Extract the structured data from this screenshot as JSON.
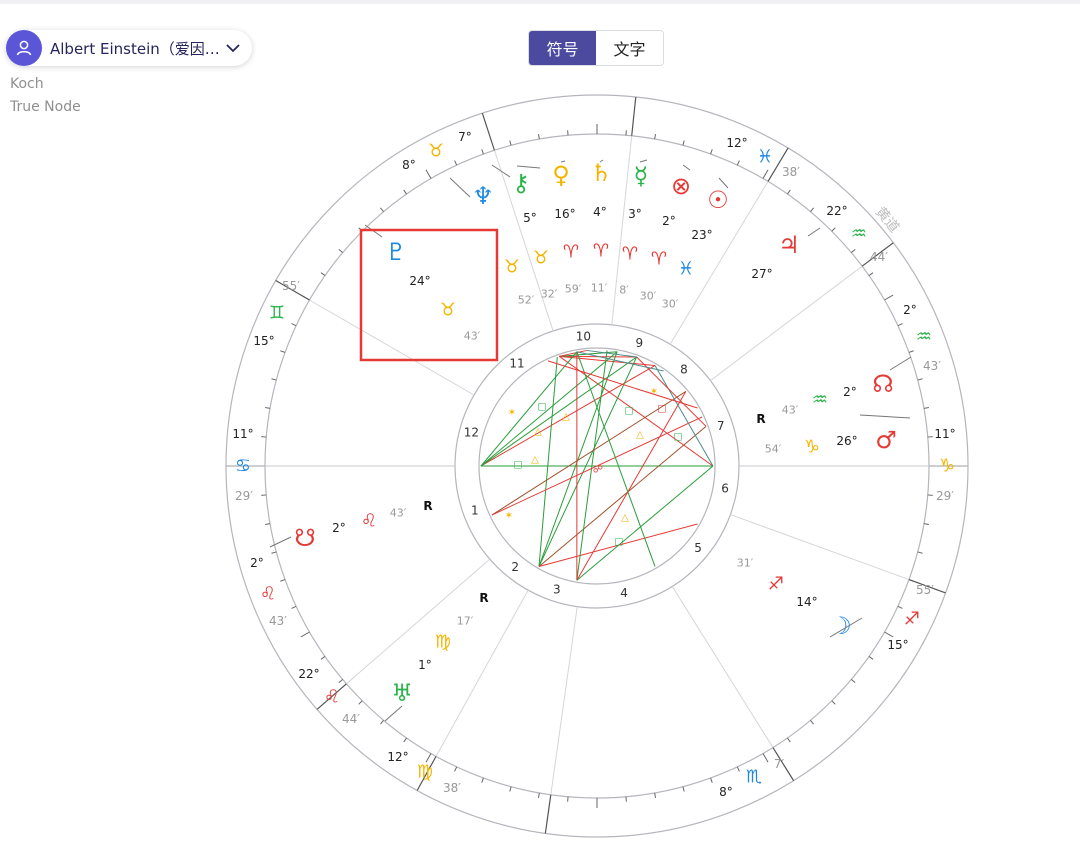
{
  "person": {
    "name": "Albert Einstein（爱因…",
    "avatar_icon": "user-icon",
    "dropdown_icon": "chevron-down-icon"
  },
  "house_system": "Koch",
  "node_type": "True Node",
  "view_toggle": {
    "symbol_label": "符号",
    "text_label": "文字",
    "selected": "symbol"
  },
  "chart": {
    "type": "natal-wheel",
    "accent_color": "#4b4a9e",
    "highlight_color": "#e53935",
    "zodiac_labels": [
      {
        "deg": "7",
        "glyph": "♉",
        "min": "",
        "color": "#f5b400",
        "name": "taurus"
      },
      {
        "deg": "8",
        "glyph": "",
        "min": "",
        "color": "#f5b400",
        "name": "taurus-deg"
      },
      {
        "deg": "12",
        "glyph": "♓",
        "min": "38",
        "color": "#1e88e5",
        "name": "pisces"
      },
      {
        "deg": "22",
        "glyph": "♒",
        "min": "44",
        "color": "#2bb34a",
        "name": "aquarius"
      },
      {
        "deg": "2",
        "glyph": "♒",
        "min": "43",
        "color": "#2bb34a",
        "name": "aquarius-2"
      },
      {
        "deg": "11",
        "glyph": "♑",
        "min": "29",
        "color": "#f5b400",
        "name": "capricorn"
      },
      {
        "deg": "15",
        "glyph": "♐",
        "min": "55",
        "color": "#e53935",
        "name": "sagittarius"
      },
      {
        "deg": "8",
        "glyph": "♏",
        "min": "7",
        "color": "#1e88e5",
        "name": "scorpio"
      },
      {
        "deg": "12",
        "glyph": "♍",
        "min": "38",
        "color": "#f5b400",
        "name": "virgo"
      },
      {
        "deg": "22",
        "glyph": "♌",
        "min": "44",
        "color": "#e53935",
        "name": "leo"
      },
      {
        "deg": "2",
        "glyph": "♌",
        "min": "43",
        "color": "#e53935",
        "name": "leo-2"
      },
      {
        "deg": "11",
        "glyph": "♋",
        "min": "29",
        "color": "#1e88e5",
        "name": "cancer"
      },
      {
        "deg": "15",
        "glyph": "♊",
        "min": "55",
        "color": "#2bb34a",
        "name": "gemini"
      }
    ],
    "ecliptic_label": "黄道",
    "planets": [
      {
        "glyph": "♆",
        "deg": "",
        "min": "",
        "sign": "",
        "name": "neptune"
      },
      {
        "glyph": "⚷",
        "deg": "5",
        "min": "52",
        "sign": "♉",
        "name": "chiron"
      },
      {
        "glyph": "♀",
        "deg": "16",
        "min": "32",
        "sign": "♉",
        "name": "venus"
      },
      {
        "glyph": "♄",
        "deg": "4",
        "min": "59",
        "sign": "♈",
        "name": "saturn"
      },
      {
        "glyph": "☿",
        "deg": "3",
        "min": "11",
        "sign": "♈",
        "name": "mercury"
      },
      {
        "glyph": "⊗",
        "deg": "2",
        "min": "8",
        "sign": "♈",
        "name": "part-of-fortune"
      },
      {
        "glyph": "☉",
        "deg": "23",
        "min": "30",
        "sign": "♈",
        "name": "sun"
      },
      {
        "glyph": "♃",
        "deg": "27",
        "min": "30",
        "sign": "♓",
        "name": "jupiter"
      },
      {
        "glyph": "♇",
        "deg": "24",
        "min": "43",
        "sign": "♉",
        "name": "pluto"
      },
      {
        "glyph": "☊",
        "deg": "2",
        "min": "43",
        "sign": "♒",
        "name": "north-node"
      },
      {
        "glyph": "♂",
        "deg": "26",
        "min": "54",
        "sign": "♑",
        "name": "mars"
      },
      {
        "glyph": "☽",
        "deg": "14",
        "min": "31",
        "sign": "♐",
        "name": "moon"
      },
      {
        "glyph": "♅",
        "deg": "1",
        "min": "17",
        "sign": "♍",
        "name": "uranus"
      },
      {
        "glyph": "☋",
        "deg": "2",
        "min": "43",
        "sign": "♌",
        "name": "south-node"
      }
    ],
    "retrograde_label": "R",
    "house_numbers": [
      "1",
      "2",
      "3",
      "4",
      "5",
      "6",
      "7",
      "8",
      "9",
      "10",
      "11",
      "12"
    ]
  }
}
